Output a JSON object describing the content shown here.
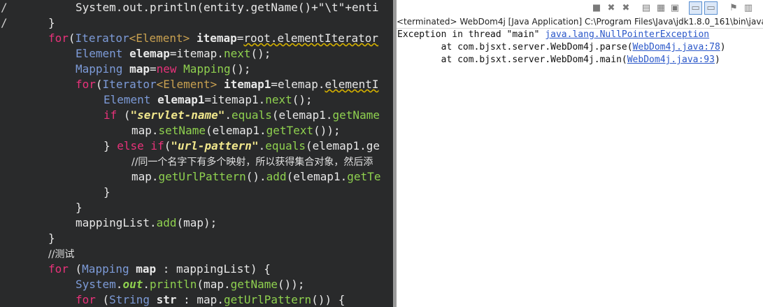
{
  "editor": {
    "lines": [
      {
        "marker": "/",
        "indent": 108,
        "parts": [
          [
            "pl",
            "System.out.println(entity.getName()+\"\\t\"+enti"
          ]
        ]
      },
      {
        "marker": "/",
        "indent": 69,
        "parts": [
          [
            "pl",
            "}"
          ]
        ]
      },
      {
        "marker": "",
        "indent": 69,
        "parts": [
          [
            "kw",
            "for"
          ],
          [
            "pl",
            "("
          ],
          [
            "cls",
            "Iterator"
          ],
          [
            "tp",
            "<Element>"
          ],
          [
            "pl",
            " "
          ],
          [
            "bold",
            "itemap"
          ],
          [
            "pl",
            "="
          ],
          [
            "sq",
            "root.elementIterator"
          ]
        ]
      },
      {
        "marker": "",
        "indent": 108,
        "parts": [
          [
            "cls",
            "Element"
          ],
          [
            "pl",
            " "
          ],
          [
            "bold",
            "elemap"
          ],
          [
            "pl",
            "=itemap."
          ],
          [
            "fn",
            "next"
          ],
          [
            "pl",
            "();"
          ]
        ]
      },
      {
        "marker": "",
        "indent": 108,
        "parts": [
          [
            "cls",
            "Mapping"
          ],
          [
            "pl",
            " "
          ],
          [
            "bold",
            "map"
          ],
          [
            "pl",
            "="
          ],
          [
            "kw",
            "new"
          ],
          [
            "pl",
            " "
          ],
          [
            "fn",
            "Mapping"
          ],
          [
            "pl",
            "();"
          ]
        ]
      },
      {
        "marker": "",
        "indent": 108,
        "parts": [
          [
            "kw",
            "for"
          ],
          [
            "pl",
            "("
          ],
          [
            "cls",
            "Iterator"
          ],
          [
            "tp",
            "<Element>"
          ],
          [
            "pl",
            " "
          ],
          [
            "bold",
            "itemap1"
          ],
          [
            "pl",
            "=elemap."
          ],
          [
            "sq",
            "elementI"
          ]
        ]
      },
      {
        "marker": "",
        "indent": 148,
        "parts": [
          [
            "cls",
            "Element"
          ],
          [
            "pl",
            " "
          ],
          [
            "bold",
            "elemap1"
          ],
          [
            "pl",
            "=itemap1."
          ],
          [
            "fn",
            "next"
          ],
          [
            "pl",
            "();"
          ]
        ]
      },
      {
        "marker": "",
        "indent": 148,
        "parts": [
          [
            "kw",
            "if"
          ],
          [
            "pl",
            " ("
          ],
          [
            "str",
            "\"servlet-name\""
          ],
          [
            "pl",
            "."
          ],
          [
            "fn",
            "equals"
          ],
          [
            "pl",
            "(elemap1."
          ],
          [
            "fn",
            "getName"
          ]
        ]
      },
      {
        "marker": "",
        "indent": 188,
        "parts": [
          [
            "pl",
            "map."
          ],
          [
            "fn",
            "setName"
          ],
          [
            "pl",
            "(elemap1."
          ],
          [
            "fn",
            "getText"
          ],
          [
            "pl",
            "());"
          ]
        ]
      },
      {
        "marker": "",
        "indent": 148,
        "parts": [
          [
            "pl",
            "} "
          ],
          [
            "kw",
            "else if"
          ],
          [
            "pl",
            "("
          ],
          [
            "str",
            "\"url-pattern\""
          ],
          [
            "pl",
            "."
          ],
          [
            "fn",
            "equals"
          ],
          [
            "pl",
            "(elemap1.ge"
          ]
        ]
      },
      {
        "marker": "",
        "indent": 188,
        "parts": [
          [
            "cm",
            "//同一个名字下有多个映射，所以获得集合对象，然后添"
          ]
        ]
      },
      {
        "marker": "",
        "indent": 188,
        "parts": [
          [
            "pl",
            "map."
          ],
          [
            "fn",
            "getUrlPattern"
          ],
          [
            "pl",
            "()."
          ],
          [
            "fn",
            "add"
          ],
          [
            "pl",
            "(elemap1."
          ],
          [
            "fn",
            "getTe"
          ]
        ]
      },
      {
        "marker": "",
        "indent": 148,
        "parts": [
          [
            "pl",
            "}"
          ]
        ]
      },
      {
        "marker": "",
        "indent": 108,
        "parts": [
          [
            "pl",
            "}"
          ]
        ]
      },
      {
        "marker": "",
        "indent": 108,
        "parts": [
          [
            "pl",
            "mappingList."
          ],
          [
            "fn",
            "add"
          ],
          [
            "pl",
            "(map);"
          ]
        ]
      },
      {
        "marker": "",
        "indent": 69,
        "parts": [
          [
            "pl",
            "}"
          ]
        ]
      },
      {
        "marker": "",
        "indent": 69,
        "parts": [
          [
            "cm",
            "//测试"
          ]
        ]
      },
      {
        "marker": "",
        "indent": 69,
        "parts": [
          [
            "kw",
            "for"
          ],
          [
            "pl",
            " ("
          ],
          [
            "cls",
            "Mapping"
          ],
          [
            "pl",
            " "
          ],
          [
            "bold",
            "map"
          ],
          [
            "pl",
            " : mappingList) {"
          ]
        ]
      },
      {
        "marker": "",
        "indent": 108,
        "parts": [
          [
            "cls",
            "System"
          ],
          [
            "pl",
            "."
          ],
          [
            "bi",
            "out"
          ],
          [
            "pl",
            "."
          ],
          [
            "fn",
            "println"
          ],
          [
            "pl",
            "(map."
          ],
          [
            "fn",
            "getName"
          ],
          [
            "pl",
            "());"
          ]
        ]
      },
      {
        "marker": "",
        "indent": 108,
        "parts": [
          [
            "kw",
            "for"
          ],
          [
            "pl",
            " ("
          ],
          [
            "cls",
            "String"
          ],
          [
            "pl",
            " "
          ],
          [
            "bold",
            "str"
          ],
          [
            "pl",
            " : map."
          ],
          [
            "fn",
            "getUrlPattern"
          ],
          [
            "pl",
            "()) {"
          ]
        ]
      }
    ]
  },
  "console": {
    "status": "<terminated> WebDom4j [Java Application] C:\\Program Files\\Java\\jdk1.8.0_161\\bin\\javaw.",
    "toolbar_icons": [
      "terminate-icon",
      "remove-launch-icon",
      "remove-all-icon",
      "scroll-lock-icon",
      "word-wrap-icon",
      "show-stdout-icon",
      "show-stderr-icon",
      "pin-console-icon",
      "display-console-icon"
    ],
    "output": [
      {
        "prefix": "Exception in thread \"main\" ",
        "link": "java.lang.NullPointerException",
        "suffix": ""
      },
      {
        "prefix": "\tat com.bjsxt.server.WebDom4j.parse(",
        "link": "WebDom4j.java:78",
        "suffix": ")"
      },
      {
        "prefix": "\tat com.bjsxt.server.WebDom4j.main(",
        "link": "WebDom4j.java:93",
        "suffix": ")"
      }
    ]
  }
}
